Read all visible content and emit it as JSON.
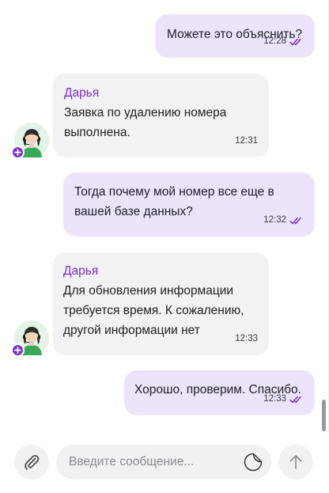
{
  "messages": [
    {
      "direction": "out",
      "text": "Можете это объяснить?",
      "time": "12:28",
      "status_icon": "double-check-icon"
    },
    {
      "direction": "in",
      "sender": "Дарья",
      "text": "Заявка по удалению номера\nвыполнена.",
      "time": "12:31"
    },
    {
      "direction": "out",
      "text": "Тогда почему мой номер все еще в\nвашей базе данных?",
      "time": "12:32",
      "status_icon": "double-check-icon"
    },
    {
      "direction": "in",
      "sender": "Дарья",
      "text": "Для обновления информации\nтребуется время. К сожалению,\nдругой информации нет",
      "time": "12:33"
    },
    {
      "direction": "out",
      "text": "Хорошо, проверим. Спасибо.",
      "time": "12:33",
      "status_icon": "double-check-icon"
    }
  ],
  "composer": {
    "placeholder": "Введите сообщение...",
    "attach_icon": "paperclip-icon",
    "emoji_icon": "sticker-icon",
    "send_icon": "arrow-up-icon"
  },
  "colors": {
    "accent": "#7a2fd6",
    "outgoing_bubble": "#ece4fb",
    "incoming_bubble": "#f2f2f4",
    "input_bg": "#f1f1f3"
  }
}
